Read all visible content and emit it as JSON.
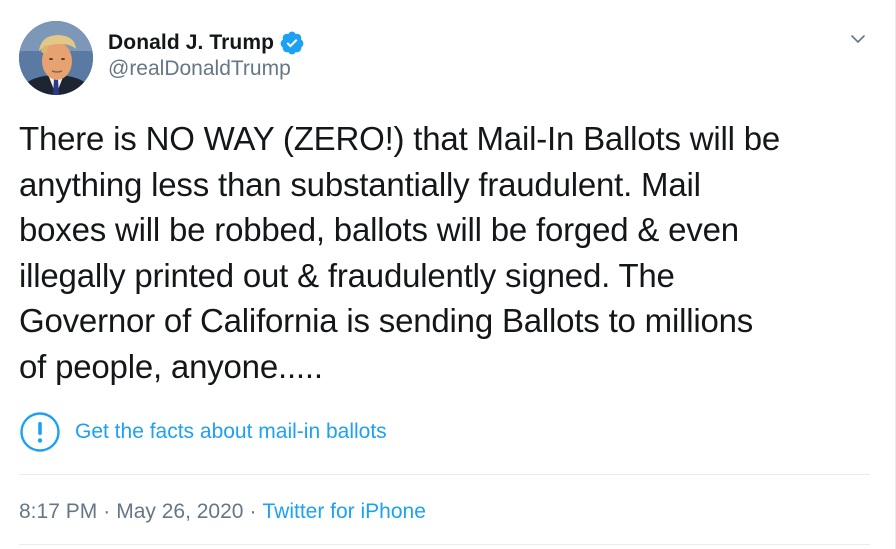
{
  "author": {
    "display_name": "Donald J. Trump",
    "handle": "@realDonaldTrump",
    "verified": true,
    "avatar_icon": "profile-photo"
  },
  "tweet": {
    "text": "There is NO WAY (ZERO!) that Mail-In Ballots will be\nanything less than substantially fraudulent. Mail\nboxes will be robbed, ballots will be forged & even\nillegally printed out & fraudulently signed. The\nGovernor of California is sending Ballots to millions\nof people, anyone....."
  },
  "facts_notice": {
    "icon": "exclamation-circle-icon",
    "label": "Get the facts about mail-in ballots"
  },
  "meta": {
    "time": "8:17 PM",
    "separator": "·",
    "date": "May 26, 2020",
    "source": "Twitter for iPhone"
  },
  "colors": {
    "link_blue": "#1da1f2",
    "text": "#14171a",
    "muted": "#657786",
    "divider": "#e6ecf0"
  }
}
